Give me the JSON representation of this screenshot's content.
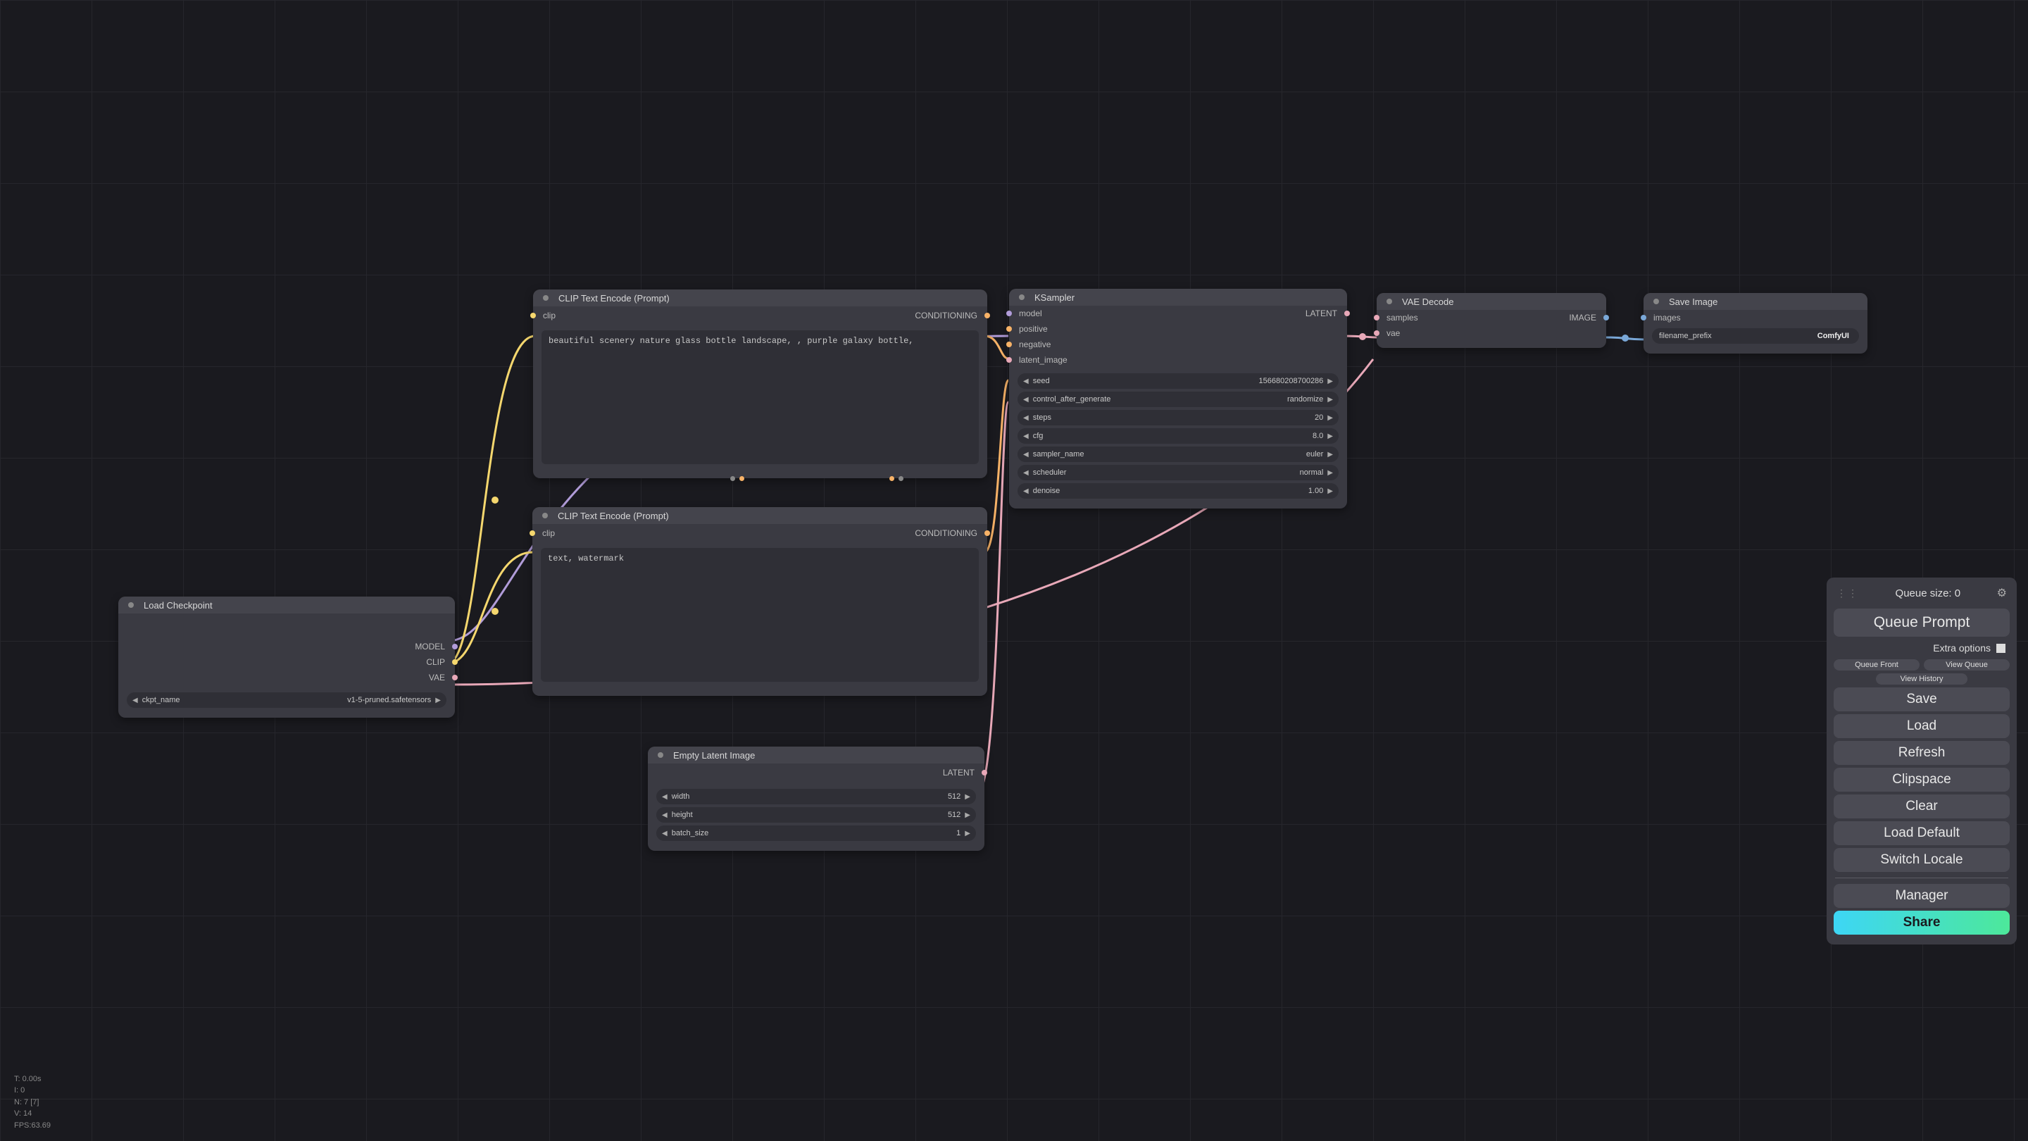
{
  "nodes": {
    "load_checkpoint": {
      "title": "Load Checkpoint",
      "outputs": {
        "model": "MODEL",
        "clip": "CLIP",
        "vae": "VAE"
      },
      "ckpt_name_label": "ckpt_name",
      "ckpt_name_value": "v1-5-pruned.safetensors"
    },
    "clip_pos": {
      "title": "CLIP Text Encode (Prompt)",
      "input_clip": "clip",
      "output_cond": "CONDITIONING",
      "text": "beautiful scenery nature glass bottle landscape, , purple galaxy bottle,"
    },
    "clip_neg": {
      "title": "CLIP Text Encode (Prompt)",
      "input_clip": "clip",
      "output_cond": "CONDITIONING",
      "text": "text, watermark"
    },
    "empty_latent": {
      "title": "Empty Latent Image",
      "output_latent": "LATENT",
      "width_label": "width",
      "width_value": "512",
      "height_label": "height",
      "height_value": "512",
      "batch_label": "batch_size",
      "batch_value": "1"
    },
    "ksampler": {
      "title": "KSampler",
      "in_model": "model",
      "in_positive": "positive",
      "in_negative": "negative",
      "in_latent": "latent_image",
      "out_latent": "LATENT",
      "seed_label": "seed",
      "seed_value": "156680208700286",
      "cag_label": "control_after_generate",
      "cag_value": "randomize",
      "steps_label": "steps",
      "steps_value": "20",
      "cfg_label": "cfg",
      "cfg_value": "8.0",
      "sampler_label": "sampler_name",
      "sampler_value": "euler",
      "scheduler_label": "scheduler",
      "scheduler_value": "normal",
      "denoise_label": "denoise",
      "denoise_value": "1.00"
    },
    "vae_decode": {
      "title": "VAE Decode",
      "in_samples": "samples",
      "in_vae": "vae",
      "out_image": "IMAGE"
    },
    "save_image": {
      "title": "Save Image",
      "in_images": "images",
      "prefix_label": "filename_prefix",
      "prefix_value": "ComfyUI"
    }
  },
  "panel": {
    "queue_size_label": "Queue size: ",
    "queue_size_value": "0",
    "queue_prompt": "Queue Prompt",
    "extra_options": "Extra options",
    "queue_front": "Queue Front",
    "view_queue": "View Queue",
    "view_history": "View History",
    "save": "Save",
    "load": "Load",
    "refresh": "Refresh",
    "clipspace": "Clipspace",
    "clear": "Clear",
    "load_default": "Load Default",
    "switch_locale": "Switch Locale",
    "manager": "Manager",
    "share": "Share"
  },
  "stats": {
    "t": "T: 0.00s",
    "i": "I: 0",
    "n": "N: 7 [7]",
    "v": "V: 14",
    "fps": "FPS:63.69"
  }
}
